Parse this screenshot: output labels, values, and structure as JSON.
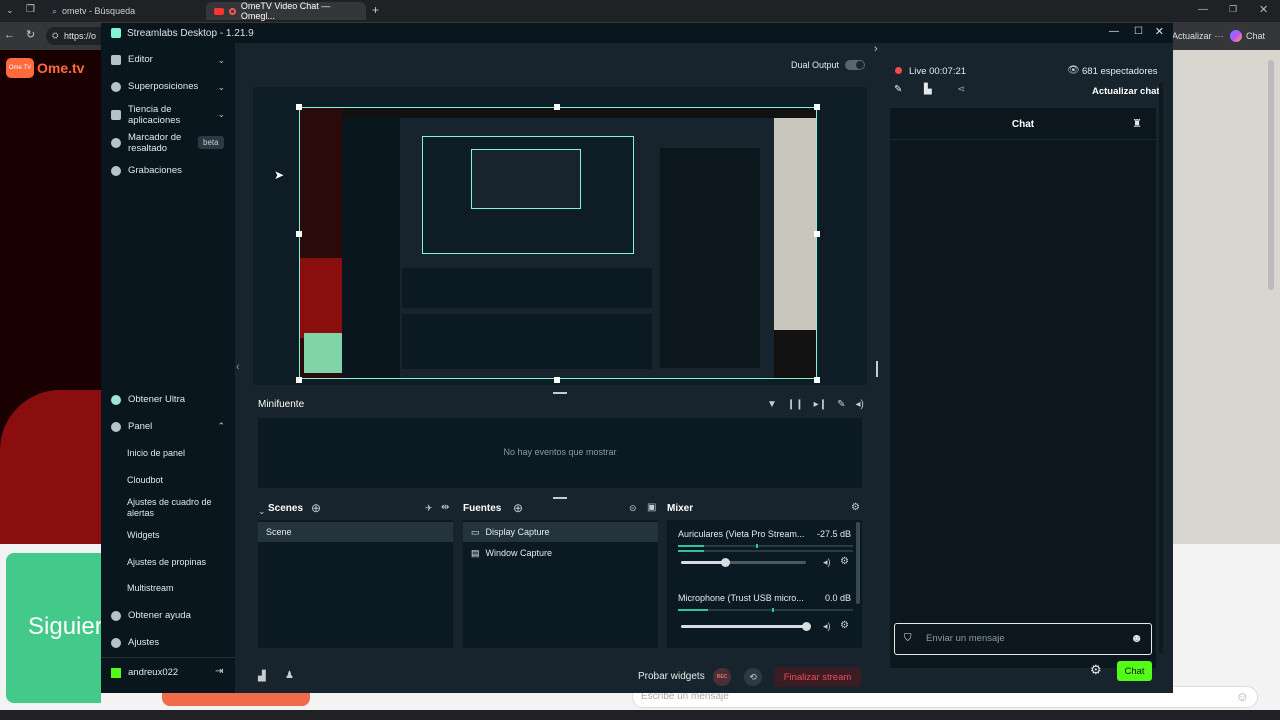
{
  "browser": {
    "tabs": [
      {
        "label": "ometv - Búsqueda"
      },
      {
        "label": "OmeTV Video Chat — Omegl..."
      }
    ],
    "new_tab": "+",
    "address": "https://o",
    "update_label": "Actualizar",
    "chat_label": "Chat"
  },
  "page": {
    "logo_text": "Ome.tv",
    "next_label": "Siguier",
    "message_placeholder": "Escribe un mensaje"
  },
  "window": {
    "title": "Streamlabs Desktop - 1.21.9"
  },
  "sidebar": {
    "items": [
      {
        "label": "Editor"
      },
      {
        "label": "Superposiciones"
      },
      {
        "label": "Tiencia de aplicaciones"
      },
      {
        "label": "Marcador de resaltado",
        "badge": "beta"
      },
      {
        "label": "Grabaciones"
      }
    ],
    "bottom": [
      {
        "label": "Obtener Ultra"
      },
      {
        "label": "Panel"
      }
    ],
    "panel_sub": [
      "Inicio de panel",
      "Cloudbot",
      "Ajustes de cuadro de alertas",
      "Widgets",
      "Ajustes de propinas",
      "Multistream"
    ],
    "help": "Obtener ayuda",
    "settings": "Ajustes",
    "user": "andreux022"
  },
  "editor": {
    "dual_output_label": "Dual Output",
    "minifuente_title": "Minifuente",
    "no_events": "No hay eventos que mostrar",
    "scenes_title": "Scenes",
    "scenes": [
      "Scene"
    ],
    "sources_title": "Fuentes",
    "sources": [
      "Display Capture",
      "Window Capture"
    ],
    "mixer_title": "Mixer",
    "mixer": [
      {
        "name": "Auriculares (Vieta Pro Stream...",
        "db": "-27.5 dB",
        "level": 0.35
      },
      {
        "name": "Microphone (Trust USB micro...",
        "db": "0.0 dB",
        "level": 1.0
      }
    ],
    "test_widgets": "Probar widgets",
    "rec_label": "REC",
    "end_stream": "Finalizar stream"
  },
  "live": {
    "status": "Live 00:07:21",
    "viewers": "681 espectadores",
    "refresh_chat": "Actualizar chat",
    "chat_title": "Chat",
    "input_placeholder": "Enviar un mensaje",
    "send": "Chat"
  },
  "colors": {
    "accent": "#80f5d2",
    "live_red": "#f04e4e",
    "end_red": "#f24a55",
    "chat_green": "#31c3a2"
  }
}
